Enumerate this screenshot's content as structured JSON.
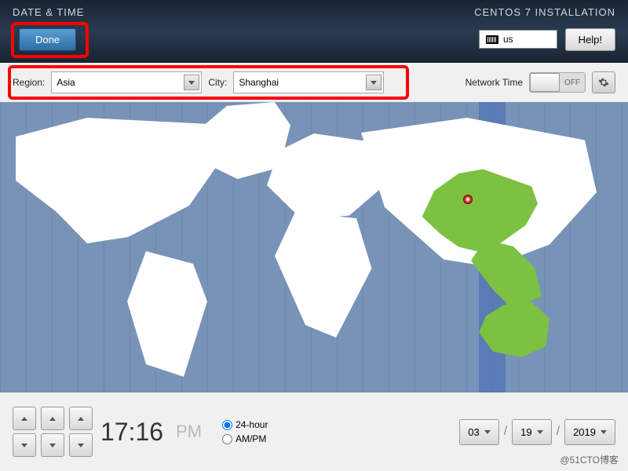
{
  "header": {
    "title": "DATE & TIME",
    "install_title": "CENTOS 7 INSTALLATION",
    "done_label": "Done",
    "keyboard_layout": "us",
    "help_label": "Help!"
  },
  "topbar": {
    "region_label": "Region:",
    "region_value": "Asia",
    "city_label": "City:",
    "city_value": "Shanghai",
    "network_time_label": "Network Time",
    "network_time_toggle": "OFF"
  },
  "map": {
    "selected_location": "Shanghai",
    "highlighted_timezone_region": "China Standard Time"
  },
  "time": {
    "hour": "17",
    "minute": "16",
    "separator": ":",
    "ampm": "PM",
    "format_24h_label": "24-hour",
    "format_ampm_label": "AM/PM",
    "format_selected": "24-hour"
  },
  "date": {
    "month": "03",
    "day": "19",
    "year": "2019"
  },
  "watermark": "@51CTO博客"
}
